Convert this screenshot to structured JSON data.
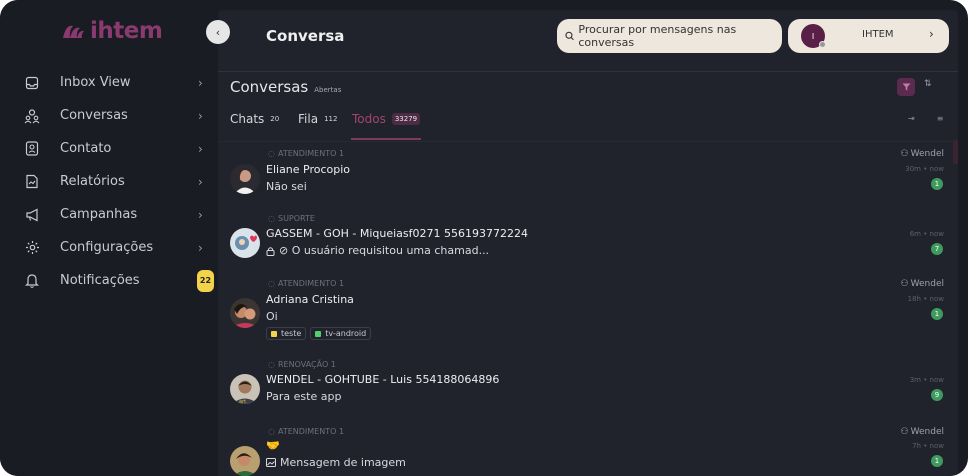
{
  "brand": {
    "name": "ihtem",
    "color": "#8a3a6e"
  },
  "sidebar": {
    "items": [
      {
        "label": "Inbox View",
        "icon": "inbox-icon"
      },
      {
        "label": "Conversas",
        "icon": "users-icon"
      },
      {
        "label": "Contato",
        "icon": "contact-icon"
      },
      {
        "label": "Relatórios",
        "icon": "report-icon"
      },
      {
        "label": "Campanhas",
        "icon": "megaphone-icon"
      },
      {
        "label": "Configurações",
        "icon": "settings-icon"
      },
      {
        "label": "Notificações",
        "icon": "bell-icon",
        "badge": "22"
      }
    ]
  },
  "header": {
    "title": "Conversa",
    "search_placeholder": "Procurar por mensagens nas conversas",
    "user": {
      "initial": "I",
      "name": "IHTEM"
    }
  },
  "conversations": {
    "title": "Conversas",
    "subtitle": "Abertas",
    "tabs": [
      {
        "label": "Chats",
        "count": "20"
      },
      {
        "label": "Fila",
        "count": "112"
      },
      {
        "label": "Todos",
        "count": "33279",
        "active": true
      }
    ],
    "items": [
      {
        "queue": "ATENDIMENTO 1",
        "name": "Eliane Procopio",
        "message": "Não sei",
        "agent": "Wendel",
        "time": "30m • now",
        "unread": "1"
      },
      {
        "queue": "SUPORTE",
        "name": "GASSEM - GOH - Miqueiasf0271 556193772224",
        "message": "⊘ O usuário requisitou uma chamad...",
        "agent": "",
        "time": "6m • now",
        "unread": "7"
      },
      {
        "queue": "ATENDIMENTO 1",
        "name": "Adriana Cristina",
        "message": "Oi",
        "agent": "Wendel",
        "time": "18h • now",
        "unread": "1",
        "tags": [
          {
            "label": "teste",
            "color": "#f2d34a"
          },
          {
            "label": "tv-android",
            "color": "#4fd16b"
          }
        ]
      },
      {
        "queue": "RENOVAÇÃO 1",
        "name": "WENDEL - GOHTUBE - Luis 554188064896",
        "message": "Para este app",
        "agent": "",
        "time": "3m • now",
        "unread": "9"
      },
      {
        "queue": "ATENDIMENTO 1",
        "name": "🤝",
        "message": "Mensagem de imagem",
        "agent": "Wendel",
        "time": "7h • now",
        "unread": "1"
      }
    ]
  }
}
